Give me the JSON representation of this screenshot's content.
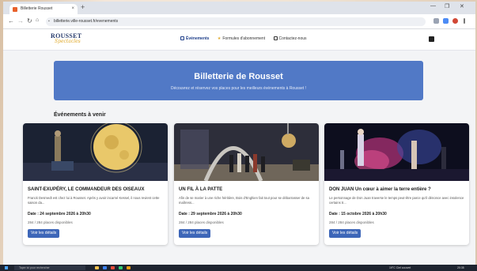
{
  "browser": {
    "tab_title": "Billetterie Rousset",
    "tab_close": "×",
    "new_tab": "+",
    "url": "billetterie.ville-rousset.fr/evenements",
    "win_min": "—",
    "win_max": "❐",
    "win_close": "✕"
  },
  "site": {
    "logo_line1": "ROUSSET",
    "logo_line2": "Spectacles",
    "nav": [
      {
        "label": "Événements",
        "icon": "calendar-icon",
        "active": true
      },
      {
        "label": "Formules d'abonnement",
        "icon": "star-icon",
        "active": false
      },
      {
        "label": "Contactez-nous",
        "icon": "mail-icon",
        "active": false
      }
    ]
  },
  "hero": {
    "title": "Billetterie de Rousset",
    "subtitle": "Découvrez et réservez vos places pour les meilleurs événements à Rousset !"
  },
  "section_title": "Événements à venir",
  "cards": [
    {
      "title": "SAINT-EXUPÉRY, LE COMMANDEUR DES OISEAUX",
      "description": "Franck Desmedt est chez lui à Rousset. Après y avoir incarné Kessel, il nous revient cette saison da...",
      "date": "Date : 24 septembre 2026 à 20h30",
      "places": "284 / 284 places disponibles",
      "button": "Voir les détails"
    },
    {
      "title": "UN FIL À LA PATTE",
      "description": "Afin de se marier à une riche héritière, Bois d'Enghien fait tout pour se débarrasser de sa maîtress...",
      "date": "Date : 29 septembre 2026 à 20h30",
      "places": "284 / 284 places disponibles",
      "button": "Voir les détails"
    },
    {
      "title": "DON JUAN Un cœur à aimer la terre entière ?",
      "description": "Le personnage de Don Juan traverse le temps peut-être parce qu'il dénonce avec insolence certains tr...",
      "date": "Date : 15 octobre 2026 à 20h30",
      "places": "284 / 284 places disponibles",
      "button": "Voir les détails"
    }
  ],
  "taskbar": {
    "search_placeholder": "Taper ici pour rechercher",
    "weather": "19°C Ciel couvert",
    "clock": "20:35"
  },
  "colors": {
    "hero": "#5179c6",
    "button": "#3d66b8",
    "nav_active": "#1f3f8a",
    "logo_accent": "#e0a92a"
  }
}
